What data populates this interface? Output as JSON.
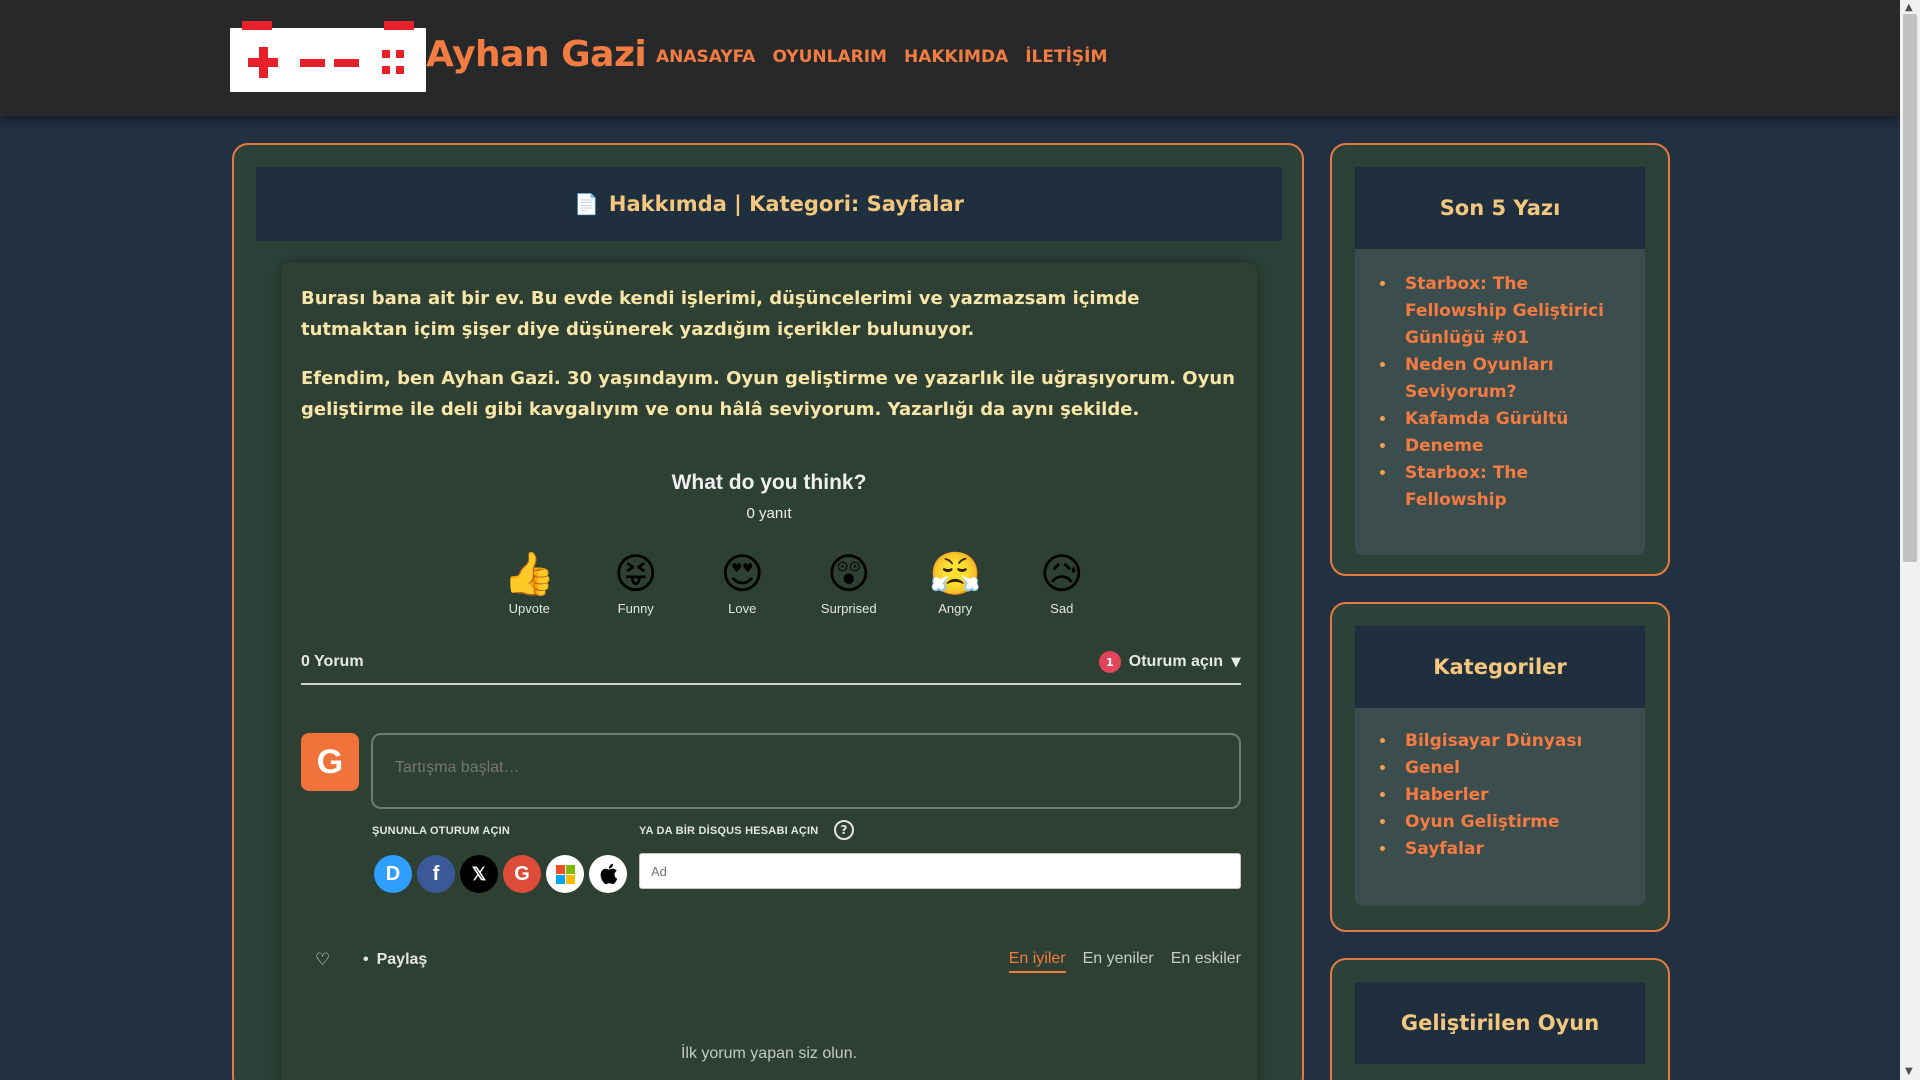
{
  "header": {
    "brand": "Ayhan Gazi",
    "nav": [
      "ANASAYFA",
      "OYUNLARIM",
      "HAKKIMDA",
      "İLETİŞİM"
    ]
  },
  "page": {
    "icon": "document-icon",
    "title": "Hakkımda | Kategori: Sayfalar",
    "paragraphs": [
      "Burası bana ait bir ev. Bu evde kendi işlerimi, düşüncelerimi ve yazmazsam içimde tutmaktan içim şişer diye düşünerek yazdığım içerikler bulunuyor.",
      "Efendim, ben Ayhan Gazi. 30 yaşındayım. Oyun geliştirme ve yazarlık ile uğraşıyorum. Oyun geliştirme ile deli gibi kavgalıyım ve onu hâlâ seviyorum. Yazarlığı da aynı şekilde."
    ]
  },
  "disqus": {
    "question": "What do you think?",
    "replies": "0 yanıt",
    "reactions": [
      {
        "label": "Upvote",
        "emoji": "👍"
      },
      {
        "label": "Funny",
        "emoji": "😝"
      },
      {
        "label": "Love",
        "emoji": "😍"
      },
      {
        "label": "Surprised",
        "emoji": "😲"
      },
      {
        "label": "Angry",
        "emoji": "😤"
      },
      {
        "label": "Sad",
        "emoji": "😥"
      }
    ],
    "comment_count": "0 Yorum",
    "notification_count": "1",
    "login_label": "Oturum açın",
    "avatar_letter": "G",
    "compose_placeholder": "Tartışma başlat…",
    "login_with_label": "ŞUNUNLA OTURUM AÇIN",
    "disqus_account_label": "YA DA BİR DİSQUS HESABI AÇIN",
    "name_placeholder": "Ad",
    "social": [
      "D",
      "f",
      "𝕏",
      "G",
      "",
      ""
    ],
    "share_label": "Paylaş",
    "sort_tabs": [
      "En iyiler",
      "En yeniler",
      "En eskiler"
    ],
    "active_sort": "En iyiler",
    "empty_message": "İlk yorum yapan siz olun."
  },
  "sidebar": {
    "recent": {
      "title": "Son 5 Yazı",
      "items": [
        "Starbox: The Fellowship Geliştirici Günlüğü #01",
        "Neden Oyunları Seviyorum?",
        "Kafamda Gürültü",
        "Deneme",
        "Starbox: The Fellowship"
      ]
    },
    "categories": {
      "title": "Kategoriler",
      "items": [
        "Bilgisayar Dünyası",
        "Genel",
        "Haberler",
        "Oyun Geliştirme",
        "Sayfalar"
      ]
    },
    "game": {
      "title": "Geliştirilen Oyun"
    }
  },
  "colors": {
    "accent": "#f37c42",
    "heading": "#f4c77f",
    "text": "#f7e6a8",
    "background": "#223141",
    "panel": "#2c4238"
  }
}
